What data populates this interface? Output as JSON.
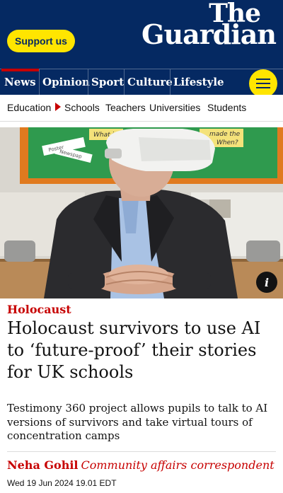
{
  "header": {
    "support_label": "Support us",
    "logo_line1": "The",
    "logo_line2": "Guardian",
    "brand_color": "#052962",
    "accent_color": "#ffe500"
  },
  "pillars": [
    {
      "label": "News",
      "active": true
    },
    {
      "label": "Opinion"
    },
    {
      "label": "Sport"
    },
    {
      "label": "Culture"
    },
    {
      "label": "Lifestyle"
    }
  ],
  "menu_icon": "hamburger-menu-icon",
  "subnav": {
    "section": "Education",
    "items": [
      "Schools",
      "Teachers",
      "Universities",
      "Students"
    ]
  },
  "hero": {
    "board_texts": [
      "What is",
      "Poster",
      "Newspap",
      "made the",
      "When?"
    ],
    "info_label": "i"
  },
  "article": {
    "kicker": "Holocaust",
    "headline": "Holocaust survivors to use AI to ‘future-proof’ their stories for UK schools",
    "standfirst": "Testimony 360 project allows pupils to talk to AI versions of survivors and take virtual tours of concentration camps",
    "author": "Neha Gohil",
    "role": "Community affairs correspondent",
    "date": "Wed 19 Jun 2024 19.01 EDT",
    "kicker_color": "#c70000"
  }
}
